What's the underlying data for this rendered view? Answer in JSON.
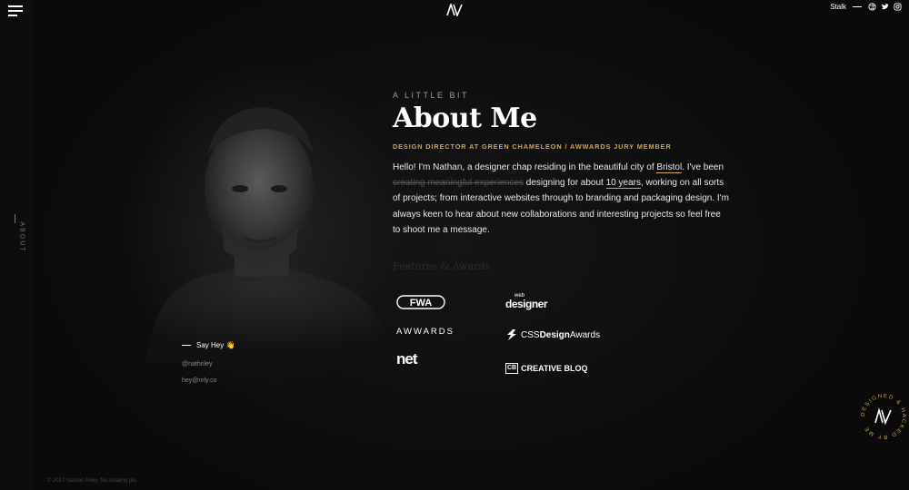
{
  "header": {
    "stalk_label": "Stalk",
    "social_icons": [
      "dribbble-icon",
      "twitter-icon",
      "instagram-icon"
    ]
  },
  "side": {
    "label": "ABOUT"
  },
  "about": {
    "eyebrow": "A LITTLE BIT",
    "title": "About Me",
    "subtitle": "DESIGN DIRECTOR AT GREEN CHAMELEON / AWWARDS JURY MEMBER",
    "bio": {
      "p1": "Hello! I'm Nathan, a designer chap residing in the beautiful city of ",
      "link_city": "Bristol",
      "p2": ". I've been ",
      "strike": "creating meaningful experiences",
      "p3": " designing for about ",
      "link_years": "10 years",
      "p4": ", working on all sorts of projects; from interactive websites through to branding and packaging design. I'm always keen to hear about new collaborations and interesting projects so feel free to shoot me a message."
    },
    "features_title": "Features & Awards",
    "awards": {
      "fwa": "FWA",
      "awwards": "AWWARDS",
      "net": "net",
      "webdesigner_small": "web",
      "webdesigner_big": "designer",
      "cssda_light": "CSS",
      "cssda_bold": "Design",
      "cssda_tail": "Awards",
      "cb_mark": "CB",
      "cb_text": "CREATIVE BLOQ"
    }
  },
  "contact": {
    "say_hey": "Say Hey 👋",
    "handle": "@nathriley",
    "email": "hey@nrly.co"
  },
  "badge": {
    "ring_text": "DESIGNED & HACKED BY ME"
  },
  "footer": {
    "copyright": "© 2017 Nathan Riley. No stealing pls."
  },
  "colors": {
    "accent": "#d3a64a",
    "background": "#0c0c0c"
  }
}
